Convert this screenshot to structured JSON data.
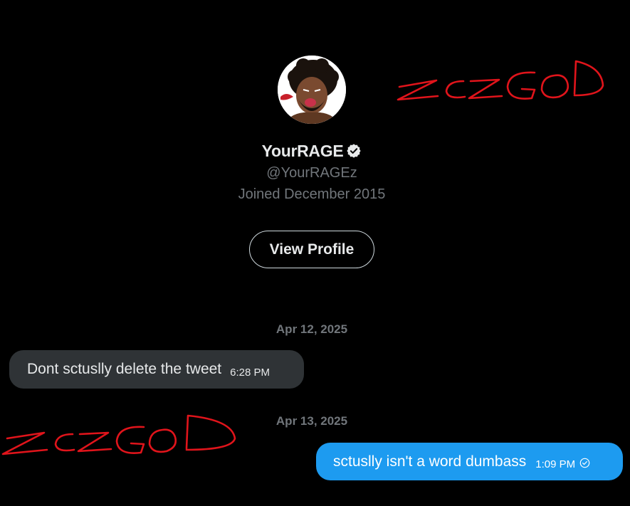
{
  "profile": {
    "display_name": "YourRAGE",
    "handle": "@YourRAGEz",
    "joined": "Joined December 2015",
    "view_profile_label": "View Profile",
    "verified_icon": "verified-badge-icon"
  },
  "conversation": {
    "groups": [
      {
        "date": "Apr 12, 2025",
        "messages": [
          {
            "direction": "received",
            "text": "Dont sctuslly delete the tweet",
            "time": "6:28 PM"
          }
        ]
      },
      {
        "date": "Apr 13, 2025",
        "messages": [
          {
            "direction": "sent",
            "text": "sctuslly isn't a word dumbass",
            "time": "1:09 PM",
            "status_icon": "seen-check-icon"
          }
        ]
      }
    ]
  },
  "annotations": {
    "scribble_top": "ZCZGOD",
    "scribble_bottom": "ZCZGOD",
    "scribble_color": "#e0141b"
  },
  "colors": {
    "background": "#000000",
    "received_bubble": "#2f3336",
    "sent_bubble": "#1d9bf0",
    "secondary_text": "#71767b",
    "primary_text": "#e7e9ea"
  }
}
